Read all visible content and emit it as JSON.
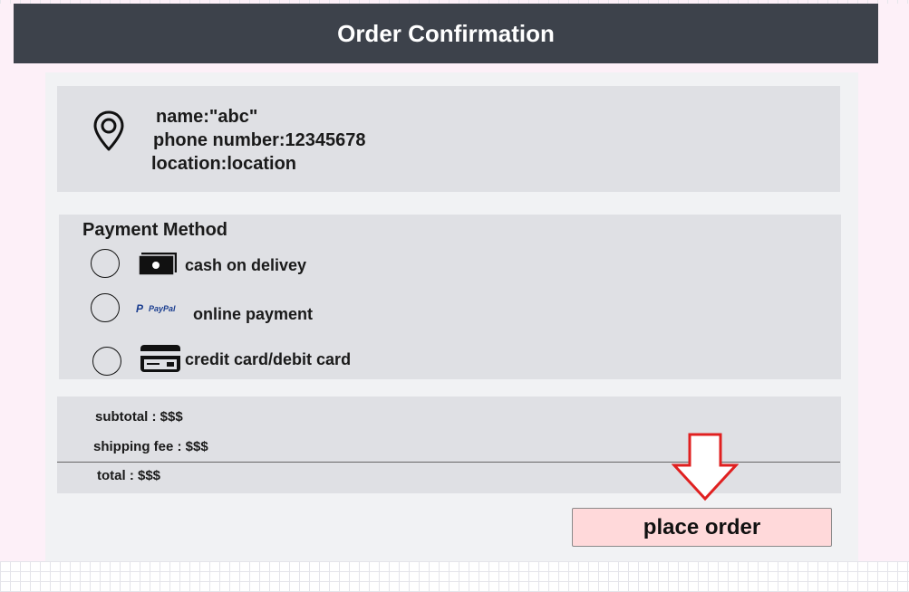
{
  "header": {
    "title": "Order Confirmation"
  },
  "address": {
    "icon": "location-pin-icon",
    "name": "name:\"abc\"",
    "phone": "phone number:12345678",
    "location": "location:location"
  },
  "payment": {
    "title": "Payment Method",
    "options": [
      {
        "label": "cash on delivey",
        "icon": "cash-icon",
        "selected": false
      },
      {
        "label": "online payment",
        "icon": "paypal-icon",
        "selected": false
      },
      {
        "label": "credit card/debit card",
        "icon": "credit-card-icon",
        "selected": false
      }
    ],
    "paypal_logo_text": "PayPal"
  },
  "summary": {
    "subtotal": "subtotal : $$$",
    "shipping": "shipping fee : $$$",
    "total": "total : $$$"
  },
  "action": {
    "place_order": "place order",
    "arrow_color": "#e02020"
  },
  "colors": {
    "header_bg": "#3d424b",
    "button_bg": "#ffd9da"
  }
}
